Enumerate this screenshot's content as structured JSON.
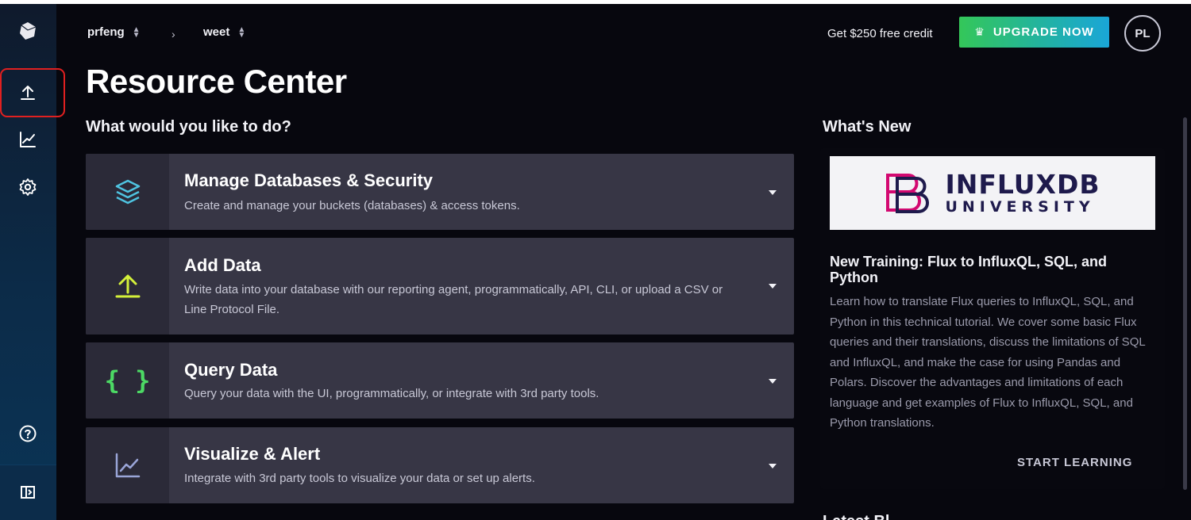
{
  "breadcrumb": {
    "org": "prfeng",
    "bucket": "weet",
    "separator": "›"
  },
  "header": {
    "credit_text": "Get $250 free credit",
    "upgrade_label": "UPGRADE NOW",
    "avatar_initials": "PL"
  },
  "page": {
    "title": "Resource Center",
    "left_section_title": "What would you like to do?",
    "right_section_title": "What's New",
    "next_section_title_partial": "Latest Bl"
  },
  "cards": [
    {
      "title": "Manage Databases & Security",
      "description": "Create and manage your buckets (databases) & access tokens.",
      "icon": "layers-icon",
      "icon_color": "#4fc3e0"
    },
    {
      "title": "Add Data",
      "description": "Write data into your database with our reporting agent, programmatically, API, CLI, or upload a CSV or Line Protocol File.",
      "icon": "upload-icon",
      "icon_color": "#d4f03a"
    },
    {
      "title": "Query Data",
      "description": "Query your data with the UI, programmatically, or integrate with 3rd party tools.",
      "icon": "braces-icon",
      "icon_color": "#4cd964"
    },
    {
      "title": "Visualize & Alert",
      "description": "Integrate with 3rd party tools to visualize your data or set up alerts.",
      "icon": "line-chart-icon",
      "icon_color": "#9aa5d8"
    }
  ],
  "news": {
    "banner_line1": "INFLUXDB",
    "banner_line2": "UNIVERSITY",
    "title": "New Training: Flux to InfluxQL, SQL, and Python",
    "body": "Learn how to translate Flux queries to InfluxQL, SQL, and Python in this technical tutorial. We cover some basic Flux queries and their translations, discuss the limitations of SQL and InfluxQL, and make the case for using Pandas and Polars. Discover the advantages and limitations of each language and get examples of Flux to InfluxQL, SQL, and Python translations.",
    "cta": "START LEARNING"
  },
  "sidebar": {
    "items": [
      {
        "icon": "influx-logo-icon"
      },
      {
        "icon": "upload-icon",
        "highlighted": true
      },
      {
        "icon": "line-chart-icon"
      },
      {
        "icon": "gear-icon"
      },
      {
        "icon": "help-icon"
      },
      {
        "icon": "collapse-sidebar-icon"
      }
    ]
  },
  "colors": {
    "background": "#07070e",
    "card": "#373645",
    "card_icon_cell": "#2b2a38",
    "highlight": "#e02020",
    "upgrade_gradient_start": "#34c759",
    "upgrade_gradient_end": "#1aa6d8"
  }
}
